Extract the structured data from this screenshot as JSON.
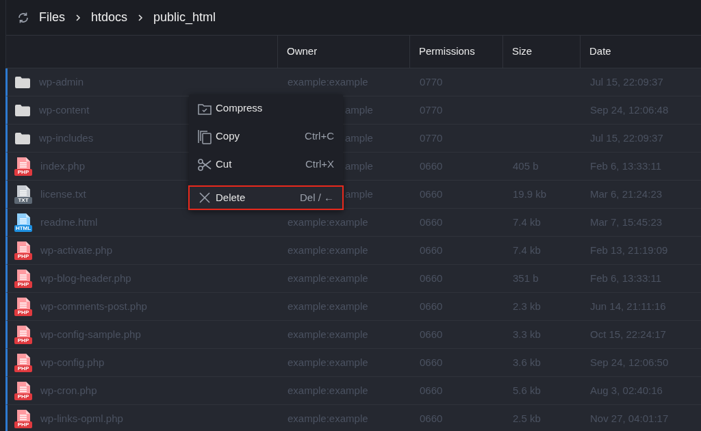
{
  "breadcrumb": [
    "Files",
    "htdocs",
    "public_html"
  ],
  "table": {
    "columns": [
      "",
      "Owner",
      "Permissions",
      "Size",
      "Date"
    ],
    "rows": [
      {
        "kind": "folder",
        "name": "wp-admin",
        "owner": "example:example",
        "permissions": "0770",
        "date": "Jul 15, 22:09:37"
      },
      {
        "kind": "folder",
        "name": "wp-content",
        "owner": "ample",
        "permissions": "0770",
        "date": "Sep 24, 12:06:48"
      },
      {
        "kind": "folder",
        "name": "wp-includes",
        "owner": "ample",
        "permissions": "0770",
        "date": "Jul 15, 22:09:37"
      },
      {
        "kind": "php",
        "badge": "PHP",
        "name": "index.php",
        "owner": "ample",
        "permissions": "0660",
        "size": "405 b",
        "date": "Feb 6, 13:33:11"
      },
      {
        "kind": "txt",
        "badge": "TXT",
        "name": "license.txt",
        "owner": "ample",
        "permissions": "0660",
        "size": "19.9 kb",
        "date": "Mar 6, 21:24:23"
      },
      {
        "kind": "html",
        "badge": "HTML",
        "name": "readme.html",
        "owner": "example:example",
        "permissions": "0660",
        "size": "7.4 kb",
        "date": "Mar 7, 15:45:23"
      },
      {
        "kind": "php",
        "badge": "PHP",
        "name": "wp-activate.php",
        "owner": "example:example",
        "permissions": "0660",
        "size": "7.4 kb",
        "date": "Feb 13, 21:19:09"
      },
      {
        "kind": "php",
        "badge": "PHP",
        "name": "wp-blog-header.php",
        "owner": "example:example",
        "permissions": "0660",
        "size": "351 b",
        "date": "Feb 6, 13:33:11"
      },
      {
        "kind": "php",
        "badge": "PHP",
        "name": "wp-comments-post.php",
        "owner": "example:example",
        "permissions": "0660",
        "size": "2.3 kb",
        "date": "Jun 14, 21:11:16"
      },
      {
        "kind": "php",
        "badge": "PHP",
        "name": "wp-config-sample.php",
        "owner": "example:example",
        "permissions": "0660",
        "size": "3.3 kb",
        "date": "Oct 15, 22:24:17"
      },
      {
        "kind": "php",
        "badge": "PHP",
        "name": "wp-config.php",
        "owner": "example:example",
        "permissions": "0660",
        "size": "3.6 kb",
        "date": "Sep 24, 12:06:50"
      },
      {
        "kind": "php",
        "badge": "PHP",
        "name": "wp-cron.php",
        "owner": "example:example",
        "permissions": "0660",
        "size": "5.6 kb",
        "date": "Aug 3, 02:40:16"
      },
      {
        "kind": "php",
        "badge": "PHP",
        "name": "wp-links-opml.php",
        "owner": "example:example",
        "permissions": "0660",
        "size": "2.5 kb",
        "date": "Nov 27, 04:01:17"
      }
    ]
  },
  "context_menu": [
    {
      "kind": "compress",
      "label": "Compress",
      "highlighted": false
    },
    {
      "kind": "copy",
      "label": "Copy",
      "shortcut": "Ctrl+C",
      "highlighted": false
    },
    {
      "kind": "cut",
      "label": "Cut",
      "shortcut": "Ctrl+X",
      "highlighted": false
    },
    {
      "kind": "delete",
      "label": "Delete",
      "shortcut": "Del / ←",
      "highlighted": true
    }
  ]
}
